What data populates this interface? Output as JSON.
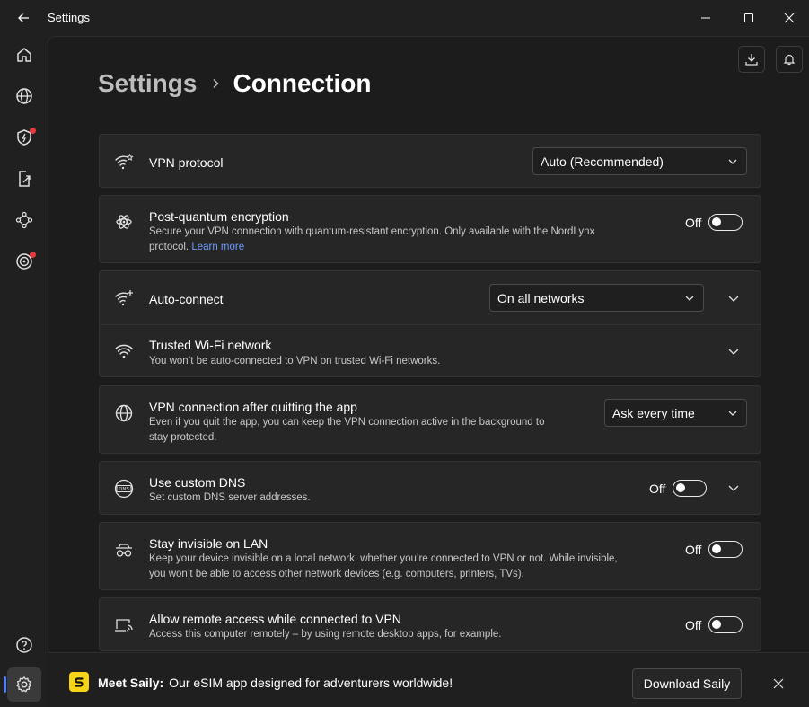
{
  "window": {
    "title": "Settings"
  },
  "icons": {
    "back": "arrow-left-icon",
    "minimize": "minimize-icon",
    "maximize": "maximize-icon",
    "close": "close-icon",
    "sidebar": [
      "home-icon",
      "globe-icon",
      "shield-bolt-icon",
      "share-file-icon",
      "meshnet-icon",
      "target-icon",
      "help-icon",
      "gear-icon"
    ]
  },
  "colors": {
    "accent": "#4c7cff",
    "link": "#6f9bff",
    "badge": "#e5393f",
    "saily": "#f7d417"
  },
  "breadcrumb": {
    "parent": "Settings",
    "current": "Connection"
  },
  "settings": {
    "vpn_protocol": {
      "title": "VPN protocol",
      "value": "Auto (Recommended)"
    },
    "pq": {
      "title": "Post-quantum encryption",
      "desc": "Secure your VPN connection with quantum-resistant encryption. Only available with the NordLynx",
      "desc2": "protocol.",
      "link": "Learn more",
      "state": "Off"
    },
    "auto_connect": {
      "title": "Auto-connect",
      "value": "On all networks"
    },
    "trusted_wifi": {
      "title": "Trusted Wi-Fi network",
      "desc": "You won’t be auto-connected to VPN on trusted Wi-Fi networks."
    },
    "after_quit": {
      "title": "VPN connection after quitting the app",
      "desc1": "Even if you quit the app, you can keep the VPN connection active in the background to",
      "desc2": "stay protected.",
      "value": "Ask every time"
    },
    "custom_dns": {
      "title": "Use custom DNS",
      "desc": "Set custom DNS server addresses.",
      "state": "Off"
    },
    "invisible_lan": {
      "title": "Stay invisible on LAN",
      "desc1": "Keep your device invisible on a local network, whether you’re connected to VPN or not. While invisible,",
      "desc2": "you won’t be able to access other network devices (e.g. computers, printers, TVs).",
      "state": "Off"
    },
    "remote_access": {
      "title": "Allow remote access while connected to VPN",
      "desc": "Access this computer remotely – by using remote desktop apps, for example.",
      "state": "Off"
    }
  },
  "banner": {
    "brand": "Meet Saily:",
    "text": "Our eSIM app designed for adventurers worldwide!",
    "button": "Download Saily"
  }
}
